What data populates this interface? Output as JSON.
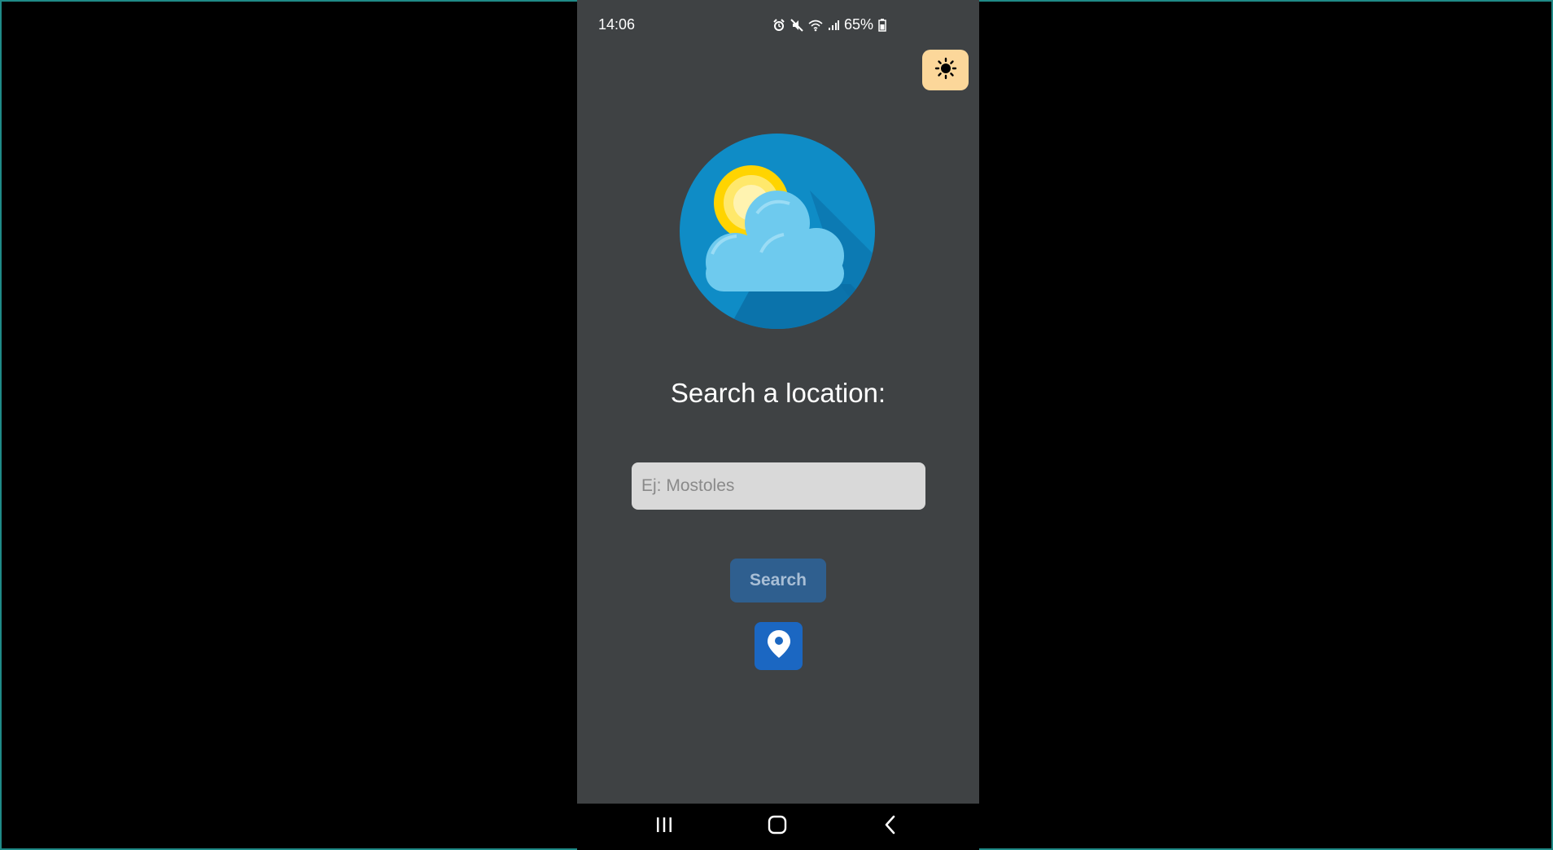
{
  "status_bar": {
    "time": "14:06",
    "battery": "65%",
    "icons": [
      "alarm-icon",
      "mute-icon",
      "wifi-icon",
      "signal-icon",
      "battery-icon"
    ]
  },
  "theme_toggle": {
    "icon": "sun-icon",
    "color": "#fcd79a"
  },
  "logo": {
    "icon": "weather-sun-cloud-icon"
  },
  "main": {
    "title": "Search a location:",
    "search_placeholder": "Ej: Mostoles",
    "search_value": "",
    "search_button_label": "Search",
    "location_icon": "map-pin-icon"
  },
  "nav_bar": {
    "items": [
      "recent-apps-icon",
      "home-icon",
      "back-icon"
    ]
  },
  "colors": {
    "app_background": "#3f4244",
    "search_button": "#2f5f8f",
    "location_button": "#1b67c2",
    "input_background": "#d9d9d9"
  }
}
